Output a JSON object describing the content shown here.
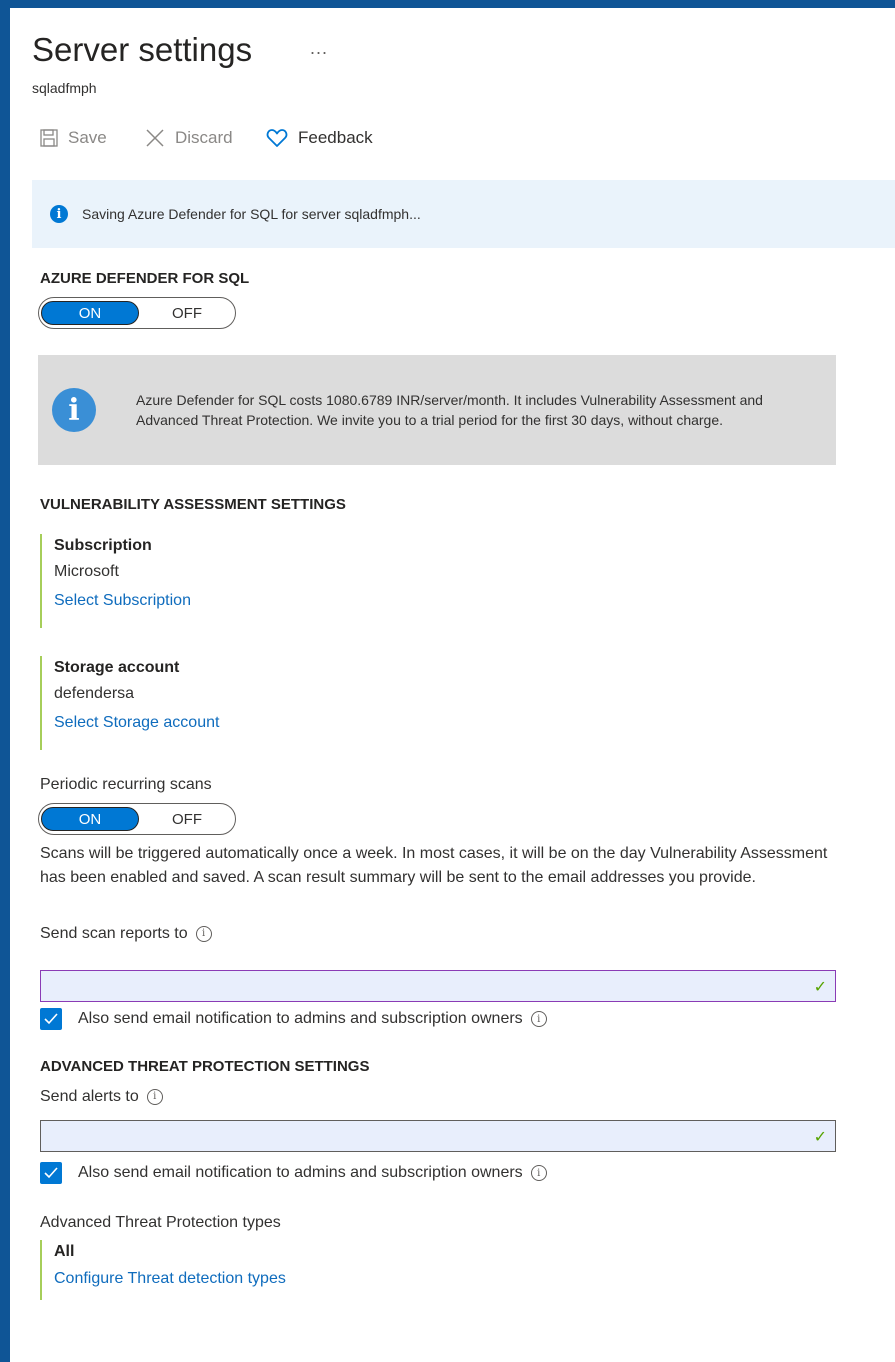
{
  "header": {
    "title": "Server settings",
    "more_label": "...",
    "subtitle": "sqladfmph"
  },
  "toolbar": {
    "save_label": "Save",
    "discard_label": "Discard",
    "feedback_label": "Feedback"
  },
  "banner": {
    "text": "Saving Azure Defender for SQL for server sqladfmph..."
  },
  "defender": {
    "heading": "AZURE DEFENDER FOR SQL",
    "toggle": {
      "on_label": "ON",
      "off_label": "OFF",
      "state": "ON"
    },
    "info": "Azure Defender for SQL costs 1080.6789 INR/server/month. It includes Vulnerability Assessment and Advanced Threat Protection. We invite you to a trial period for the first 30 days, without charge."
  },
  "va": {
    "heading": "VULNERABILITY ASSESSMENT SETTINGS",
    "subscription": {
      "label": "Subscription",
      "value": "Microsoft",
      "link": "Select Subscription"
    },
    "storage": {
      "label": "Storage account",
      "value": "defendersa",
      "link": "Select Storage account"
    },
    "periodic": {
      "label": "Periodic recurring scans",
      "toggle": {
        "on_label": "ON",
        "off_label": "OFF",
        "state": "ON"
      },
      "description": "Scans will be triggered automatically once a week. In most cases, it will be on the day Vulnerability Assessment has been enabled and saved. A scan result summary will be sent to the email addresses you provide."
    },
    "send_reports": {
      "label": "Send scan reports to",
      "value": ""
    },
    "also_send": {
      "label": "Also send email notification to admins and subscription owners",
      "checked": true
    }
  },
  "atp": {
    "heading": "ADVANCED THREAT PROTECTION SETTINGS",
    "send_alerts": {
      "label": "Send alerts to",
      "value": ""
    },
    "also_send": {
      "label": "Also send email notification to admins and subscription owners",
      "checked": true
    },
    "types": {
      "label": "Advanced Threat Protection types",
      "value": "All",
      "link": "Configure Threat detection types"
    }
  },
  "colors": {
    "accent": "#0078d4",
    "frame": "#0f5596",
    "valid": "#57a300"
  }
}
